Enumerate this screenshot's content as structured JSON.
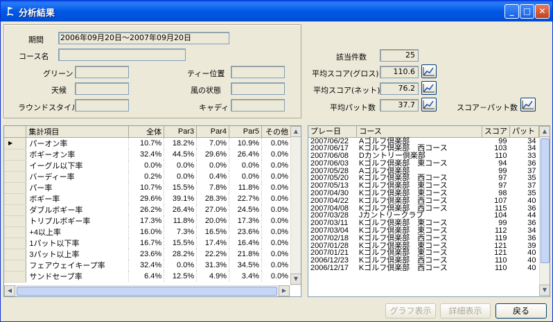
{
  "window": {
    "title": "分析結果"
  },
  "filters": {
    "period_label": "期間",
    "period_value": "2006年09月20日～2007年09月20日",
    "course_label": "コース名",
    "course_value": "",
    "green_label": "グリーン",
    "weather_label": "天候",
    "round_style_label": "ラウンドスタイル",
    "tee_label": "ティー位置",
    "wind_label": "風の状態",
    "caddie_label": "キャディ"
  },
  "stats": {
    "count_label": "該当件数",
    "count_value": "25",
    "gross_label": "平均スコア(グロス)",
    "gross_value": "110.6",
    "net_label": "平均スコア(ネット)",
    "net_value": "76.2",
    "putt_label": "平均パット数",
    "putt_value": "37.7",
    "score_putt_label": "スコア－パット数"
  },
  "summary_table": {
    "columns": [
      "集計項目",
      "全体",
      "Par3",
      "Par4",
      "Par5",
      "その他"
    ],
    "rows": [
      [
        "パーオン率",
        "10.7%",
        "18.2%",
        "7.0%",
        "10.9%",
        "0.0%"
      ],
      [
        "ボギーオン率",
        "32.4%",
        "44.5%",
        "29.6%",
        "26.4%",
        "0.0%"
      ],
      [
        "イーグル以下率",
        "0.0%",
        "0.0%",
        "0.0%",
        "0.0%",
        "0.0%"
      ],
      [
        "バーディー率",
        "0.2%",
        "0.0%",
        "0.4%",
        "0.0%",
        "0.0%"
      ],
      [
        "パー率",
        "10.7%",
        "15.5%",
        "7.8%",
        "11.8%",
        "0.0%"
      ],
      [
        "ボギー率",
        "29.6%",
        "39.1%",
        "28.3%",
        "22.7%",
        "0.0%"
      ],
      [
        "ダブルボギー率",
        "26.2%",
        "26.4%",
        "27.0%",
        "24.5%",
        "0.0%"
      ],
      [
        "トリプルボギー率",
        "17.3%",
        "11.8%",
        "20.0%",
        "17.3%",
        "0.0%"
      ],
      [
        "+4以上率",
        "16.0%",
        "7.3%",
        "16.5%",
        "23.6%",
        "0.0%"
      ],
      [
        "1パット以下率",
        "16.7%",
        "15.5%",
        "17.4%",
        "16.4%",
        "0.0%"
      ],
      [
        "3パット以上率",
        "23.6%",
        "28.2%",
        "22.2%",
        "21.8%",
        "0.0%"
      ],
      [
        "フェアウェイキープ率",
        "32.4%",
        "0.0%",
        "31.3%",
        "34.5%",
        "0.0%"
      ],
      [
        "サンドセーブ率",
        "6.4%",
        "12.5%",
        "4.9%",
        "3.4%",
        "0.0%"
      ]
    ]
  },
  "rounds_table": {
    "columns": [
      "プレー日",
      "コース",
      "スコア",
      "パット"
    ],
    "rows": [
      [
        "2007/06/22",
        "Aゴルフ倶楽部",
        "99",
        "34"
      ],
      [
        "2007/06/17",
        "Kゴルフ倶楽部　西コース",
        "103",
        "34"
      ],
      [
        "2007/06/08",
        "Dカントリー倶楽部",
        "110",
        "33"
      ],
      [
        "2007/06/03",
        "Kゴルフ倶楽部　東コース",
        "94",
        "36"
      ],
      [
        "2007/05/28",
        "Aゴルフ倶楽部",
        "99",
        "37"
      ],
      [
        "2007/05/20",
        "Kゴルフ倶楽部　西コース",
        "97",
        "35"
      ],
      [
        "2007/05/13",
        "Kゴルフ倶楽部　東コース",
        "97",
        "37"
      ],
      [
        "2007/04/30",
        "Kゴルフ倶楽部　東コース",
        "98",
        "35"
      ],
      [
        "2007/04/22",
        "Kゴルフ倶楽部　西コース",
        "107",
        "40"
      ],
      [
        "2007/04/08",
        "Kゴルフ倶楽部　西コース",
        "115",
        "36"
      ],
      [
        "2007/03/28",
        "Jカントリークラブ",
        "104",
        "44"
      ],
      [
        "2007/03/11",
        "Kゴルフ倶楽部　東コース",
        "99",
        "36"
      ],
      [
        "2007/03/04",
        "Kゴルフ倶楽部　東コース",
        "112",
        "34"
      ],
      [
        "2007/02/18",
        "Kゴルフ倶楽部　西コース",
        "119",
        "36"
      ],
      [
        "2007/01/28",
        "Kゴルフ倶楽部　東コース",
        "121",
        "39"
      ],
      [
        "2007/01/21",
        "Kゴルフ倶楽部　東コース",
        "121",
        "40"
      ],
      [
        "2006/12/23",
        "Kゴルフ倶楽部　西コース",
        "110",
        "40"
      ],
      [
        "2006/12/17",
        "Kゴルフ倶楽部　西コース",
        "110",
        "40"
      ]
    ]
  },
  "buttons": {
    "graph": "グラフ表示",
    "detail": "詳細表示",
    "back": "戻る"
  }
}
